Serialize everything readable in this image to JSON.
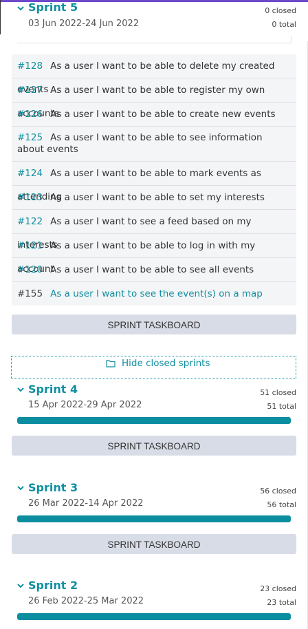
{
  "sprints": [
    {
      "name": "Sprint 5",
      "dates": "03 Jun 2022-24 Jun 2022",
      "closed": "0 closed",
      "total": "0 total",
      "progress": 0
    },
    {
      "name": "Sprint 4",
      "dates": "15 Apr 2022-29 Apr 2022",
      "closed": "51 closed",
      "total": "51 total",
      "progress": 1
    },
    {
      "name": "Sprint 3",
      "dates": "26 Mar 2022-14 Apr 2022",
      "closed": "56 closed",
      "total": "56 total",
      "progress": 1
    },
    {
      "name": "Sprint 2",
      "dates": "26 Feb 2022-25 Mar 2022",
      "closed": "23 closed",
      "total": "23 total",
      "progress": 1
    }
  ],
  "stories": [
    {
      "id": "#128",
      "title": "As a user I want to be able to delete my created events"
    },
    {
      "id": "#127",
      "title": "As a user I want to be able to register my own accounts"
    },
    {
      "id": "#126",
      "title": "As a user I want to be able to create new events"
    },
    {
      "id": "#125",
      "title": "As a user I want to be able to see information about events"
    },
    {
      "id": "#124",
      "title": "As a user I want to be able to mark events as attending"
    },
    {
      "id": "#123",
      "title": "As a user I want to be able to set my interests"
    },
    {
      "id": "#122",
      "title": "As a user I want to see a feed based on my interests"
    },
    {
      "id": "#121",
      "title": "As a user I want to be able to log in with my account"
    },
    {
      "id": "#120",
      "title": "As a user I want to be able to see all events"
    },
    {
      "id": "#155",
      "title": "As a user I want to see the event(s) on a map"
    }
  ],
  "taskboard_label": "SPRINT TASKBOARD",
  "hide_closed_label": "Hide closed sprints",
  "icons": {
    "chevron": "chevron-down-icon",
    "folder": "folder-icon"
  },
  "colors": {
    "accent": "#0f8fa0",
    "progress": "#0b8ea0",
    "button": "#d8dce6",
    "list_bg": "#f4f5f7",
    "topbar": "#6e49cb"
  }
}
